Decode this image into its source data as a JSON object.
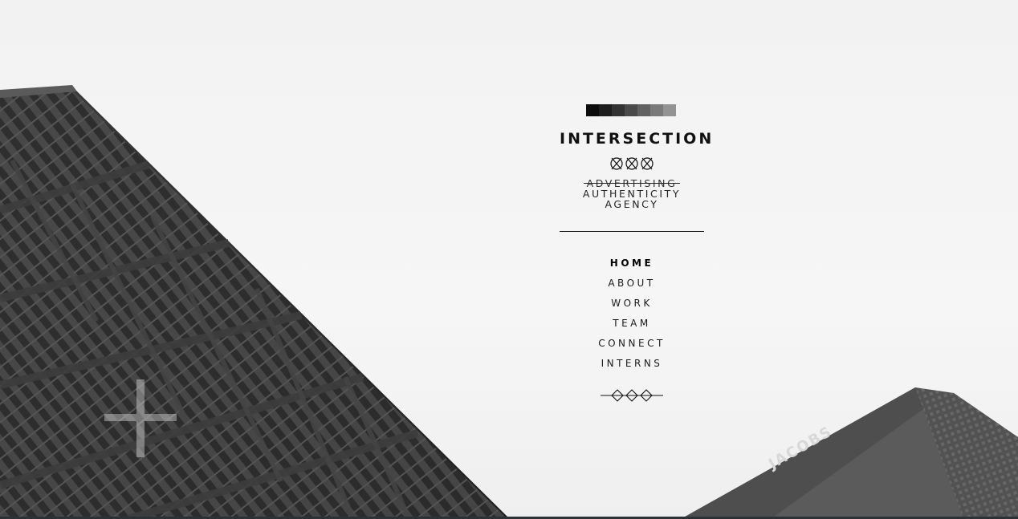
{
  "brand": {
    "title": "INTERSECTION",
    "swatch_colors": [
      "#0c0c0c",
      "#1e1e1e",
      "#333333",
      "#4a4a4a",
      "#626262",
      "#7a7a7a",
      "#939393"
    ],
    "xxx_mark": "xxx-mark",
    "tagline_struck": "ADVERTISING",
    "tagline_line2": "AUTHENTICITY",
    "tagline_line3": "AGENCY"
  },
  "nav": {
    "home": "HOME",
    "about": "ABOUT",
    "work": "WORK",
    "team": "TEAM",
    "connect": "CONNECT",
    "interns": "INTERNS"
  },
  "ornament": "diamond-divider-icon",
  "building_sign": "JACOBS"
}
